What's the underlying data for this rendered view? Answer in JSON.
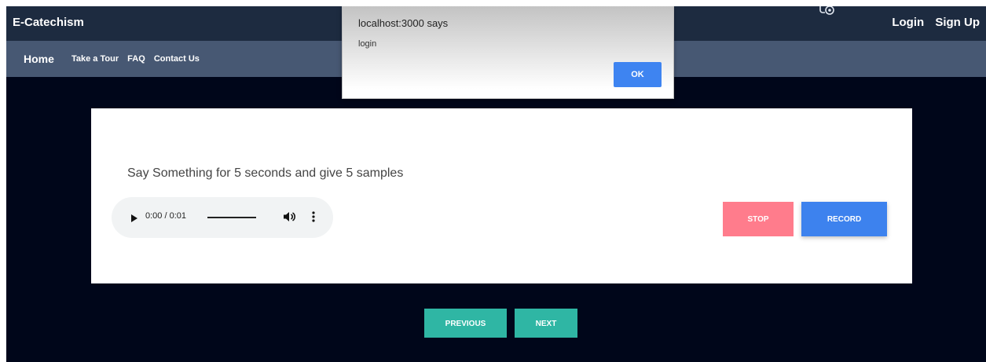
{
  "header": {
    "brand": "E-Catechism",
    "icon": "accessibility-icon",
    "login": "Login",
    "signup": "Sign Up"
  },
  "nav": {
    "home": "Home",
    "links": [
      "Take a Tour",
      "FAQ",
      "Contact Us"
    ]
  },
  "card": {
    "prompt": "Say Something for 5 seconds and give 5 samples",
    "player": {
      "time": "0:00 / 0:01",
      "play_icon": "play-icon",
      "volume_icon": "volume-icon",
      "more_icon": "more-vertical-icon"
    },
    "stop_label": "STOP",
    "record_label": "RECORD"
  },
  "pager": {
    "previous_label": "PREVIOUS",
    "next_label": "NEXT"
  },
  "dialog": {
    "title": "localhost:3000 says",
    "message": "login",
    "ok_label": "OK"
  },
  "colors": {
    "page_bg": "#00061a",
    "topbar": "#1d2b40",
    "subnav": "#475873",
    "stop": "#ff7c8c",
    "record": "#3d82ee",
    "pager": "#2fb6a4",
    "ok": "#3e84f1"
  }
}
